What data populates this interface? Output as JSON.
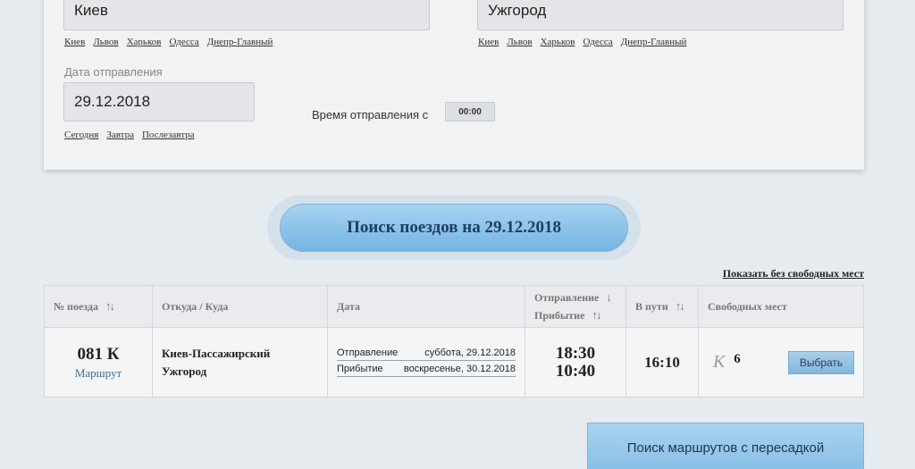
{
  "from": {
    "value": "Киев",
    "quick_links": [
      "Киев",
      "Львов",
      "Харьков",
      "Одесса",
      "Днепр-Главный"
    ]
  },
  "to": {
    "value": "Ужгород",
    "quick_links": [
      "Киев",
      "Львов",
      "Харьков",
      "Одесса",
      "Днепр-Главный"
    ]
  },
  "departure_date": {
    "label": "Дата отправления",
    "value": "29.12.2018",
    "quick_links": [
      "Сегодня",
      "Завтра",
      "Послезавтра"
    ]
  },
  "departure_time": {
    "label": "Время отправления с",
    "value": "00:00"
  },
  "search_button": "Поиск поездов на 29.12.2018",
  "show_without_seats": "Показать без свободных мест",
  "table": {
    "headers": {
      "train_no": "№ поезда",
      "from_to": "Откуда / Куда",
      "date": "Дата",
      "departure": "Отправление",
      "arrival": "Прибытие",
      "duration": "В пути",
      "seats": "Свободных мест"
    },
    "rows": [
      {
        "train_no": "081 К",
        "route_link": "Маршрут",
        "from_station": "Киев-Пассажирский",
        "to_station": "Ужгород",
        "departure_label": "Отправление",
        "departure_date": "суббота, 29.12.2018",
        "arrival_label": "Прибытие",
        "arrival_date": "воскресенье, 30.12.2018",
        "departure_time": "18:30",
        "arrival_time": "10:40",
        "duration": "16:10",
        "seat_class": "К",
        "seat_count": "6",
        "select_label": "Выбрать"
      }
    ]
  },
  "transfer_button": "Поиск маршрутов с пересадкой",
  "icons": {
    "sort": "sort-arrows-icon",
    "sort_down": "arrow-down-icon"
  }
}
